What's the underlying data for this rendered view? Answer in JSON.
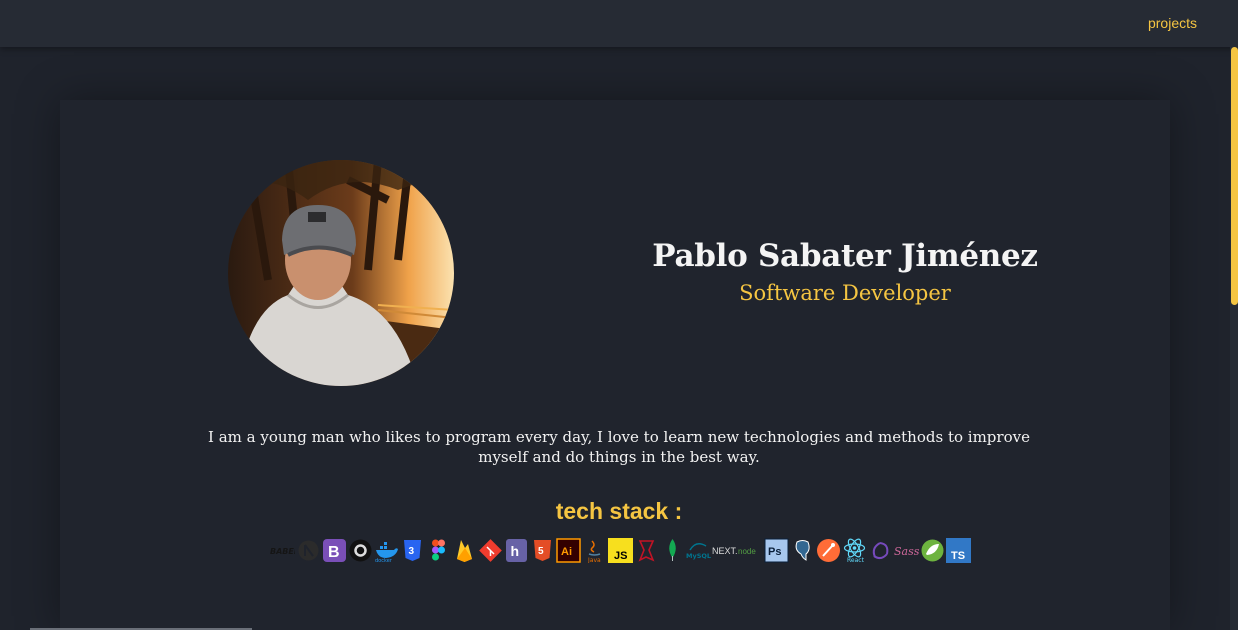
{
  "nav": {
    "projects_label": "projects"
  },
  "profile": {
    "name": "Pablo Sabater Jiménez",
    "role": "Software Developer",
    "bio": "I am a young man who likes to program every day, I love to learn new technologies and methods to improve myself and do things in the best way."
  },
  "tech_stack": {
    "title": "tech stack :",
    "items": [
      "babel-icon",
      "next-icon",
      "bootstrap-icon",
      "circle-icon",
      "docker-icon",
      "css3-icon",
      "figma-icon",
      "firebase-icon",
      "git-icon",
      "heroku-icon",
      "html5-icon",
      "illustrator-icon",
      "java-icon",
      "javascript-icon",
      "jest-icon",
      "mongodb-icon",
      "mysql-icon",
      "nextjs-icon",
      "nodejs-icon",
      "photoshop-icon",
      "postgresql-icon",
      "postman-icon",
      "react-icon",
      "redux-icon",
      "sass-icon",
      "spring-icon",
      "typescript-icon"
    ]
  },
  "colors": {
    "accent": "#f5c542",
    "background": "#1f232c",
    "topbar": "#262b34"
  }
}
